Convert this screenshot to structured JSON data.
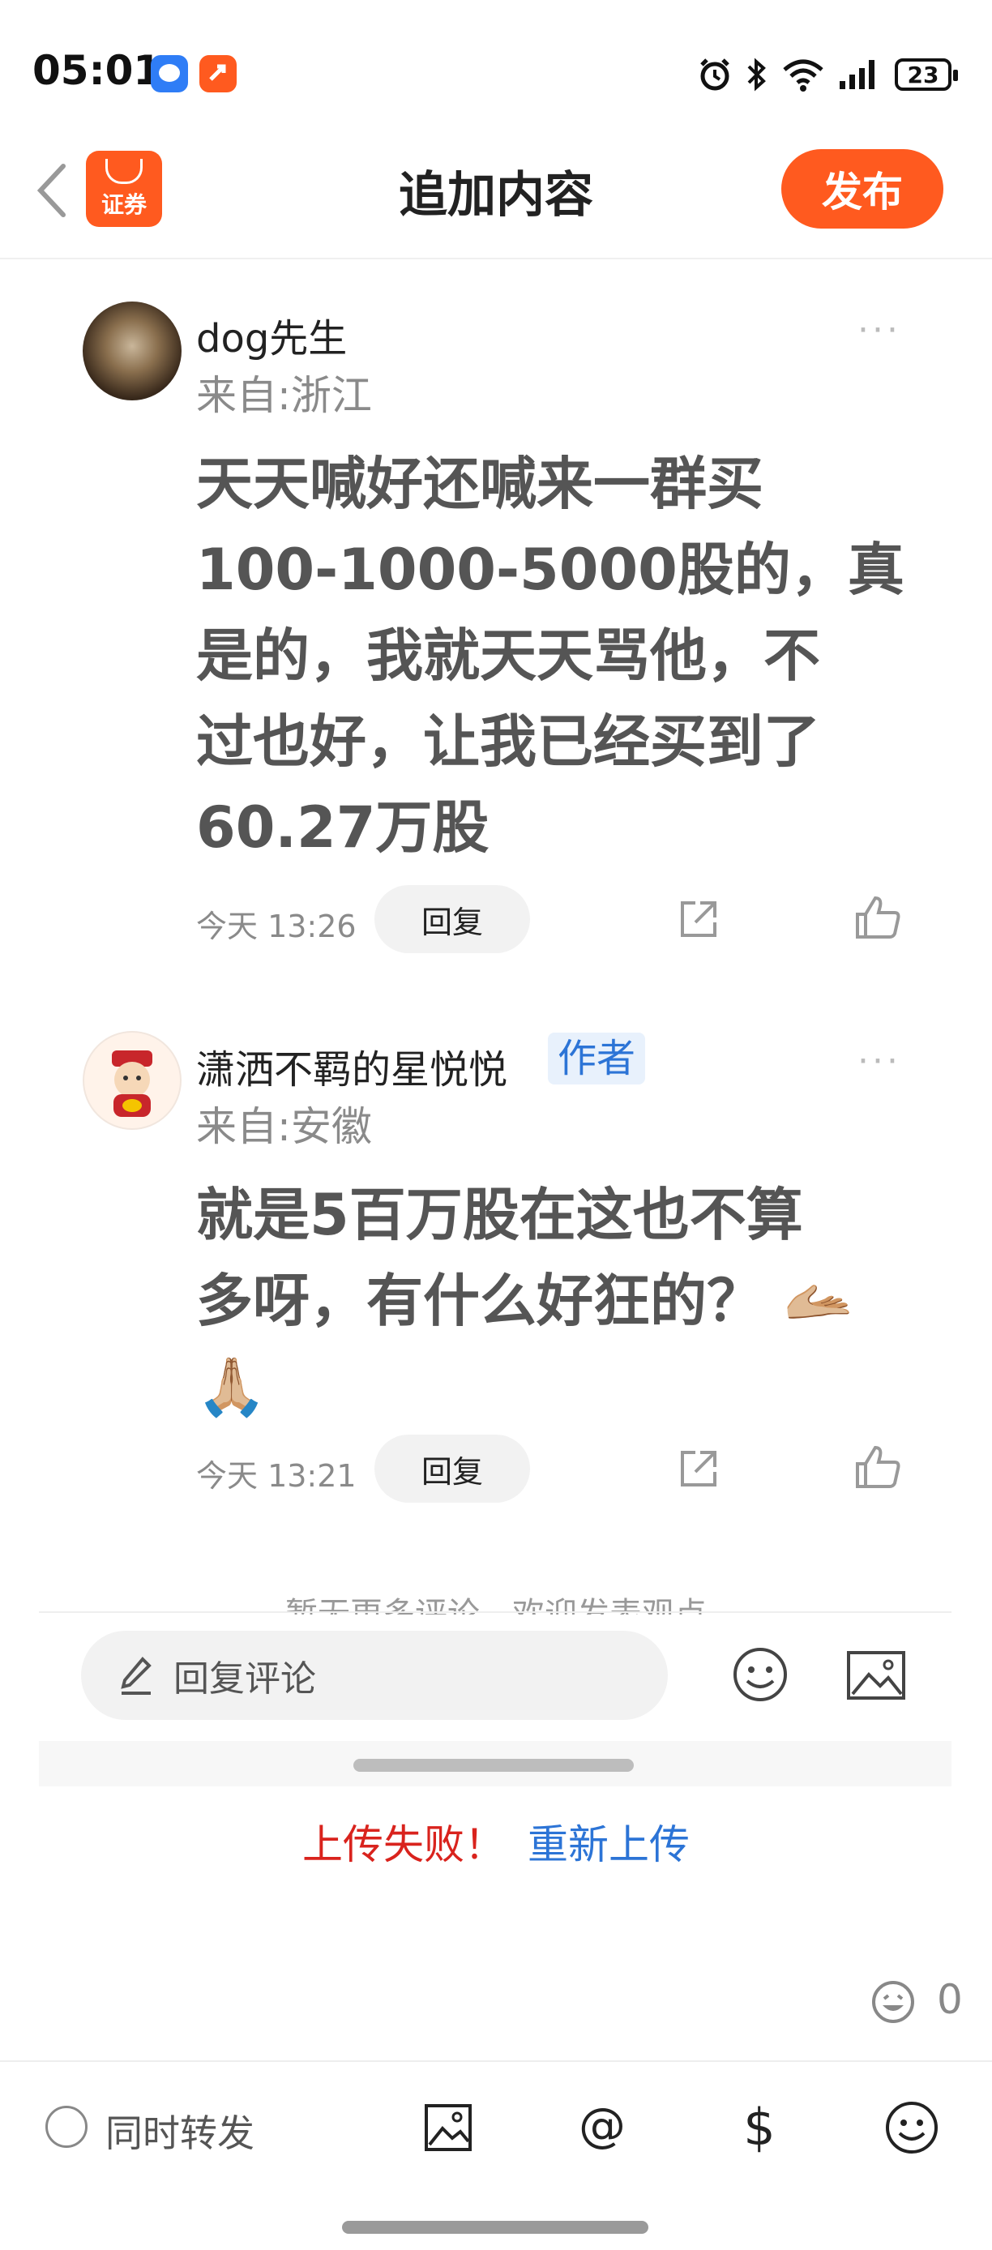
{
  "status_bar": {
    "time": "05:01",
    "battery": "23",
    "icons": [
      "chat-app-icon",
      "securities-app-icon",
      "alarm-icon",
      "bluetooth-icon",
      "wifi-icon",
      "signal-icon",
      "battery-icon"
    ]
  },
  "header": {
    "logo_text": "证券",
    "title": "追加内容",
    "publish_label": "发布"
  },
  "comments": [
    {
      "user": "dog先生",
      "location": "来自:浙江",
      "lines": [
        "天天喊好还喊来一群买",
        "100-1000-5000股的，真",
        "是的，我就天天骂他，不",
        "过也好，让我已经买到了",
        "60.27万股"
      ],
      "time": "今天 13:26",
      "reply_label": "回复",
      "more": "···"
    },
    {
      "user": "潇洒不羁的星悦悦",
      "tag": "作者",
      "location": "来自:安徽",
      "lines": [
        "就是5百万股在这也不算",
        "多呀，有什么好狂的？ 🫴🏼",
        "🙏🏼"
      ],
      "time": "今天 13:21",
      "reply_label": "回复",
      "more": "···"
    }
  ],
  "no_more_text": "暂无更多评论，欢迎发表观点",
  "reply_input": {
    "placeholder": "回复评论"
  },
  "upload": {
    "failed": "上传失败！",
    "retry": "重新上传"
  },
  "emoji_count": "0",
  "toolbar": {
    "sync_label": "同时转发",
    "icons": [
      "image-icon",
      "at-icon",
      "dollar-icon",
      "emoji-icon"
    ]
  },
  "colors": {
    "accent": "#ff5a1f",
    "link_blue": "#2c74d6",
    "error_red": "#d9231d"
  }
}
